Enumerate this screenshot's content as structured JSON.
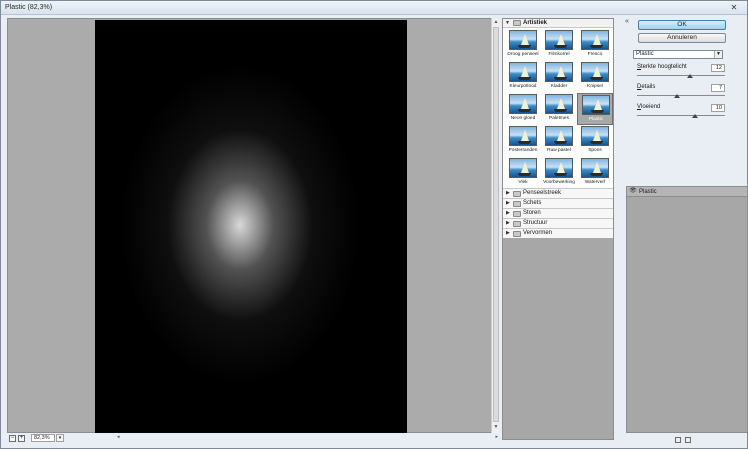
{
  "window": {
    "title": "Plastic (82,3%)",
    "close_glyph": "✕"
  },
  "statusbar": {
    "zoom_value": "82,3%",
    "zoom_menu_glyph": "▾",
    "minus_glyph": "−",
    "plus_glyph": "+"
  },
  "gallery": {
    "open_category": "Artistiek",
    "filters": [
      "Droog penseel",
      "Filmkorrel",
      "Fresco",
      "Kleurpotlood",
      "Kladder",
      "Knipsel",
      "Neon gloed",
      "Paletmes",
      "Plastic",
      "Posterranden",
      "Ruw pastel",
      "Spons",
      "Vlek",
      "Voorbewerking",
      "Waterverf"
    ],
    "selected_filter": "Plastic",
    "other_categories": [
      "Penseelstreek",
      "Schets",
      "Storen",
      "Structuur",
      "Vervormen"
    ]
  },
  "panel": {
    "ok_label": "OK",
    "cancel_label": "Annuleren",
    "collapse_glyph": "«",
    "filter_select": "Plastic",
    "params": [
      {
        "label_u": "S",
        "label_rest": "terkte hoogtelicht",
        "value": "12",
        "fraction": 0.6
      },
      {
        "label_u": "D",
        "label_rest": "etails",
        "value": "7",
        "fraction": 0.46
      },
      {
        "label_u": "V",
        "label_rest": "loeiend",
        "value": "10",
        "fraction": 0.66
      }
    ],
    "layer_name": "Plastic",
    "eye_glyph": "👁"
  },
  "icons": {
    "open_tri": "▼",
    "closed_tri": "▶",
    "scroll_up": "▲",
    "scroll_down": "▼",
    "scroll_left": "◂",
    "scroll_right": "▸"
  }
}
